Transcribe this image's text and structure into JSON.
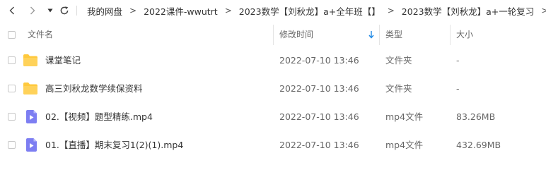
{
  "breadcrumb": {
    "items": [
      {
        "label": "我的网盘"
      },
      {
        "label": "2022课件-wwutrt"
      },
      {
        "label": "2023数学【刘秋龙】a+全年班【】"
      },
      {
        "label": "2023数学【刘秋龙】a+一轮复习"
      }
    ],
    "separator": ">"
  },
  "table": {
    "columns": {
      "name": "文件名",
      "modified": "修改时间",
      "type": "类型",
      "size": "大小"
    },
    "sorted_by": "modified",
    "rows": [
      {
        "name": "课堂笔记",
        "modified": "2022-07-10 13:46",
        "type": "文件夹",
        "size": "-",
        "icon": "folder-icon"
      },
      {
        "name": "高三刘秋龙数学续保资料",
        "modified": "2022-07-10 13:46",
        "type": "文件夹",
        "size": "-",
        "icon": "folder-icon"
      },
      {
        "name": "02.【视频】题型精练.mp4",
        "modified": "2022-07-10 13:46",
        "type": "mp4文件",
        "size": "83.26MB",
        "icon": "video-file-icon"
      },
      {
        "name": "01.【直播】期末复习1(2)(1).mp4",
        "modified": "2022-07-10 13:46",
        "type": "mp4文件",
        "size": "432.69MB",
        "icon": "video-file-icon"
      }
    ]
  },
  "colors": {
    "folder": "#FFC93D",
    "video": "#7D7EF2",
    "sort_arrow": "#1E88E5"
  }
}
